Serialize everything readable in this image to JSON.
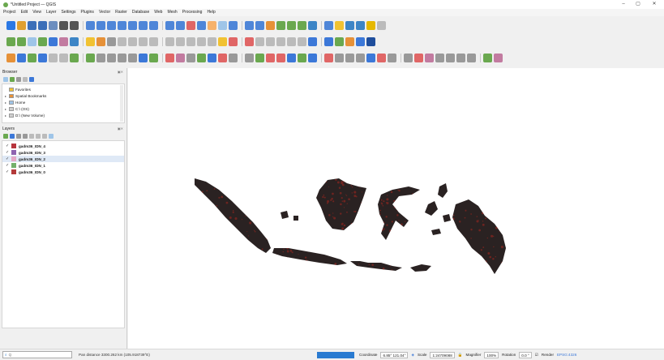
{
  "window": {
    "title": "*Untitled Project — QGIS",
    "min": "–",
    "max": "▢",
    "close": "✕"
  },
  "menu": [
    "Project",
    "Edit",
    "View",
    "Layer",
    "Settings",
    "Plugins",
    "Vector",
    "Raster",
    "Database",
    "Web",
    "Mesh",
    "Processing",
    "Help"
  ],
  "toolbars": {
    "row1": [
      "#2b78e4",
      "#e0a030",
      "#3c6fb8",
      "#3c6fb8",
      "#6c8ebf",
      "#555",
      "#555",
      "#4f86d8",
      "#4f86d8",
      "#4f86d8",
      "#4f86d8",
      "#4f86d8",
      "#4f86d8",
      "#4f86d8",
      "#4f86d8",
      "#4f86d8",
      "#e06666",
      "#4f86d8",
      "#f6b26b",
      "#9fc5e8",
      "#4f86d8",
      "#4f86d8",
      "#4f86d8",
      "#e69138",
      "#6aa84f",
      "#6aa84f",
      "#6aa84f",
      "#3d85c6",
      "#4f86d8",
      "#f1c232",
      "#3d85c6",
      "#3d85c6",
      "#e6b800",
      "#bbb"
    ],
    "row2": [
      "#6aa84f",
      "#6aa84f",
      "#9fc5e8",
      "#6aa84f",
      "#3c78d8",
      "#c27ba0",
      "#3d85c6",
      "#f1c232",
      "#e69138",
      "#999",
      "#bbb",
      "#bbb",
      "#bbb",
      "#bbb",
      "#bbb",
      "#bbb",
      "#bbb",
      "#bbb",
      "#bbb",
      "#f1c232",
      "#e06666",
      "#e06666",
      "#bbb",
      "#bbb",
      "#bbb",
      "#bbb",
      "#bbb",
      "#3c78d8",
      "#3c78d8",
      "#6aa84f",
      "#e69138",
      "#3c78d8",
      "#1f4e9c"
    ],
    "row3": [
      "#e69138",
      "#3c78d8",
      "#6aa84f",
      "#3c78d8",
      "#bbb",
      "#bbb",
      "#6aa84f",
      "#6aa84f",
      "#999",
      "#999",
      "#999",
      "#999",
      "#3c78d8",
      "#6aa84f",
      "#e06666",
      "#c27ba0",
      "#999",
      "#6aa84f",
      "#3c78d8",
      "#e06666",
      "#999",
      "#999",
      "#6aa84f",
      "#e06666",
      "#e06666",
      "#3c78d8",
      "#6aa84f",
      "#3c78d8",
      "#e06666",
      "#999",
      "#999",
      "#999",
      "#3c78d8",
      "#e06666",
      "#999",
      "#999",
      "#e06666",
      "#c27ba0",
      "#999",
      "#999",
      "#999",
      "#999",
      "#6aa84f",
      "#c27ba0"
    ]
  },
  "browser": {
    "title": "Browser",
    "items": [
      {
        "arrow": "",
        "label": "Favorites",
        "color": "#f1c232"
      },
      {
        "arrow": "▸",
        "label": "Spatial Bookmarks",
        "color": "#e69138"
      },
      {
        "arrow": "▸",
        "label": "Home",
        "color": "#9fc5e8"
      },
      {
        "arrow": "▸",
        "label": "C:\\ (OS)",
        "color": "#cfcfcf"
      },
      {
        "arrow": "▸",
        "label": "D:\\ (New Volume)",
        "color": "#cfcfcf"
      }
    ]
  },
  "layers": {
    "title": "Layers",
    "items": [
      {
        "label": "gadm36_IDN_4",
        "color": "#b7343c",
        "selected": false
      },
      {
        "label": "gadm36_IDN_3",
        "color": "#8e63b0",
        "selected": false
      },
      {
        "label": "gadm36_IDN_2",
        "color": "#e6a8c6",
        "selected": true
      },
      {
        "label": "gadm36_IDN_1",
        "color": "#74b06b",
        "selected": false
      },
      {
        "label": "gadm36_IDN_0",
        "color": "#b33a3a",
        "selected": false
      }
    ]
  },
  "status": {
    "search_placeholder": "Q",
    "message": "Pan distance 3300.262 km (105.918739°E)",
    "coordinate_label": "Coordinate",
    "coordinate": "6.85° 121.04°",
    "scale_label": "Scale",
    "scale": "1:24709088",
    "magnifier_label": "Magnifier",
    "magnifier": "100%",
    "rotation_label": "Rotation",
    "rotation": "0.0 °",
    "render_label": "Render",
    "crs": "EPSG:4326"
  },
  "colors": {
    "land": "#2a2222",
    "speckle": "#7a2520"
  }
}
